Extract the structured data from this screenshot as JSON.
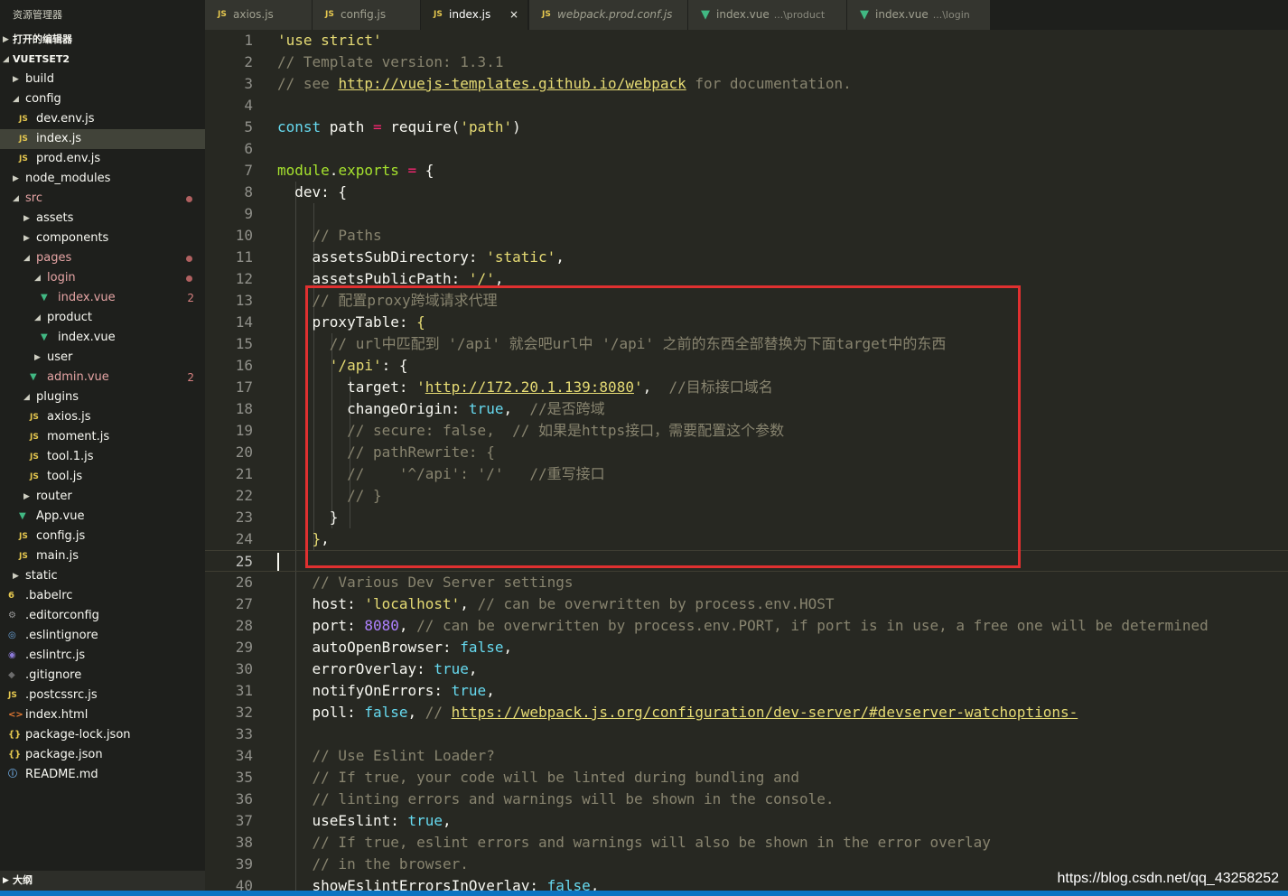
{
  "sidebar": {
    "title": "资源管理器",
    "open_editors": "打开的编辑器",
    "project": "VUETSET2",
    "tree": [
      {
        "name": "build",
        "kind": "folder",
        "depth": 0,
        "expanded": false
      },
      {
        "name": "config",
        "kind": "folder",
        "depth": 0,
        "expanded": true
      },
      {
        "name": "dev.env.js",
        "kind": "js",
        "depth": 1
      },
      {
        "name": "index.js",
        "kind": "js",
        "depth": 1,
        "selected": true
      },
      {
        "name": "prod.env.js",
        "kind": "js",
        "depth": 1
      },
      {
        "name": "node_modules",
        "kind": "folder",
        "depth": 0,
        "expanded": false
      },
      {
        "name": "src",
        "kind": "folder",
        "depth": 0,
        "expanded": true,
        "modified": true,
        "dot": true
      },
      {
        "name": "assets",
        "kind": "folder",
        "depth": 1,
        "expanded": false
      },
      {
        "name": "components",
        "kind": "folder",
        "depth": 1,
        "expanded": false
      },
      {
        "name": "pages",
        "kind": "folder",
        "depth": 1,
        "expanded": true,
        "modified": true,
        "dot": true
      },
      {
        "name": "login",
        "kind": "folder",
        "depth": 2,
        "expanded": true,
        "modified": true,
        "dot": true
      },
      {
        "name": "index.vue",
        "kind": "vue",
        "depth": 3,
        "modified": true,
        "count": "2"
      },
      {
        "name": "product",
        "kind": "folder",
        "depth": 2,
        "expanded": true
      },
      {
        "name": "index.vue",
        "kind": "vue",
        "depth": 3
      },
      {
        "name": "user",
        "kind": "folder",
        "depth": 2,
        "expanded": false
      },
      {
        "name": "admin.vue",
        "kind": "vue",
        "depth": 2,
        "modified": true,
        "count": "2"
      },
      {
        "name": "plugins",
        "kind": "folder",
        "depth": 1,
        "expanded": true
      },
      {
        "name": "axios.js",
        "kind": "js",
        "depth": 2
      },
      {
        "name": "moment.js",
        "kind": "js",
        "depth": 2
      },
      {
        "name": "tool.1.js",
        "kind": "js",
        "depth": 2
      },
      {
        "name": "tool.js",
        "kind": "js",
        "depth": 2
      },
      {
        "name": "router",
        "kind": "folder",
        "depth": 1,
        "expanded": false
      },
      {
        "name": "App.vue",
        "kind": "vue",
        "depth": 1
      },
      {
        "name": "config.js",
        "kind": "js",
        "depth": 1
      },
      {
        "name": "main.js",
        "kind": "js",
        "depth": 1
      },
      {
        "name": "static",
        "kind": "folder",
        "depth": 0,
        "expanded": false
      },
      {
        "name": ".babelrc",
        "kind": "babel",
        "depth": 0
      },
      {
        "name": ".editorconfig",
        "kind": "gear",
        "depth": 0
      },
      {
        "name": ".eslintignore",
        "kind": "eslint-ignore",
        "depth": 0
      },
      {
        "name": ".eslintrc.js",
        "kind": "eslint",
        "depth": 0
      },
      {
        "name": ".gitignore",
        "kind": "git",
        "depth": 0
      },
      {
        "name": ".postcssrc.js",
        "kind": "js",
        "depth": 0
      },
      {
        "name": "index.html",
        "kind": "html",
        "depth": 0
      },
      {
        "name": "package-lock.json",
        "kind": "json",
        "depth": 0
      },
      {
        "name": "package.json",
        "kind": "json",
        "depth": 0
      },
      {
        "name": "README.md",
        "kind": "info",
        "depth": 0
      }
    ],
    "outline": "大纲"
  },
  "icons": {
    "js": "JS",
    "vue": "▼",
    "json": "{}",
    "html": "<>",
    "info": "ⓘ",
    "gear": "⚙",
    "eslint": "◉",
    "eslint-ignore": "◎",
    "git": "◆",
    "babel": "6",
    "caret_right": "▶",
    "caret_down": "◢"
  },
  "tabs": [
    {
      "label": "axios.js",
      "icon": "js"
    },
    {
      "label": "config.js",
      "icon": "js"
    },
    {
      "label": "index.js",
      "icon": "js",
      "active": true,
      "close": "×"
    },
    {
      "label": "webpack.prod.conf.js",
      "icon": "js",
      "italic": true
    },
    {
      "label": "index.vue",
      "icon": "vue",
      "desc": "...\\product"
    },
    {
      "label": "index.vue",
      "icon": "vue",
      "desc": "...\\login"
    }
  ],
  "editor": {
    "current_line": 25,
    "lines": [
      [
        [
          "s",
          "'use strict'"
        ]
      ],
      [
        [
          "c",
          "// Template version: 1.3.1"
        ]
      ],
      [
        [
          "c",
          "// see "
        ],
        [
          "u",
          "http://vuejs-templates.github.io/webpack"
        ],
        [
          "c",
          " for documentation."
        ]
      ],
      [],
      [
        [
          "kw",
          "const "
        ],
        [
          "pl",
          "path "
        ],
        [
          "op",
          "= "
        ],
        [
          "pl",
          "require"
        ],
        [
          "pl",
          "("
        ],
        [
          "s",
          "'path'"
        ],
        [
          "pl",
          ")"
        ]
      ],
      [],
      [
        [
          "pr",
          "module"
        ],
        [
          "pl",
          "."
        ],
        [
          "pr",
          "exports"
        ],
        [
          "pl",
          " "
        ],
        [
          "op",
          "="
        ],
        [
          "pl",
          " {"
        ]
      ],
      [
        [
          "pl",
          "  dev: {"
        ]
      ],
      [],
      [
        [
          "c",
          "    // Paths"
        ]
      ],
      [
        [
          "pl",
          "    assetsSubDirectory: "
        ],
        [
          "s",
          "'static'"
        ],
        [
          "pl",
          ","
        ]
      ],
      [
        [
          "pl",
          "    assetsPublicPath: "
        ],
        [
          "s",
          "'/'"
        ],
        [
          "pl",
          ","
        ]
      ],
      [
        [
          "c",
          "    // 配置proxy跨域请求代理"
        ]
      ],
      [
        [
          "pl",
          "    proxyTable: "
        ],
        [
          "s",
          "{"
        ]
      ],
      [
        [
          "c",
          "      // url中匹配到 '/api' 就会吧url中 '/api' 之前的东西全部替换为下面target中的东西"
        ]
      ],
      [
        [
          "pl",
          "      "
        ],
        [
          "s",
          "'/api'"
        ],
        [
          "pl",
          ": {"
        ]
      ],
      [
        [
          "pl",
          "        target: "
        ],
        [
          "s",
          "'"
        ],
        [
          "u",
          "http://172.20.1.139:8080"
        ],
        [
          "s",
          "'"
        ],
        [
          "pl",
          ",  "
        ],
        [
          "c",
          "//目标接口域名"
        ]
      ],
      [
        [
          "pl",
          "        changeOrigin: "
        ],
        [
          "kw",
          "true"
        ],
        [
          "pl",
          ",  "
        ],
        [
          "c",
          "//是否跨域"
        ]
      ],
      [
        [
          "c",
          "        // secure: false,  // 如果是https接口，需要配置这个参数"
        ]
      ],
      [
        [
          "c",
          "        // pathRewrite: {"
        ]
      ],
      [
        [
          "c",
          "        //    '^/api': '/'   //重写接口"
        ]
      ],
      [
        [
          "c",
          "        // }"
        ]
      ],
      [
        [
          "pl",
          "      }"
        ]
      ],
      [
        [
          "s",
          "    }"
        ],
        [
          "pl",
          ","
        ]
      ],
      [],
      [
        [
          "c",
          "    // Various Dev Server settings"
        ]
      ],
      [
        [
          "pl",
          "    host: "
        ],
        [
          "s",
          "'localhost'"
        ],
        [
          "pl",
          ", "
        ],
        [
          "c",
          "// can be overwritten by process.env.HOST"
        ]
      ],
      [
        [
          "pl",
          "    port: "
        ],
        [
          "v",
          "8080"
        ],
        [
          "pl",
          ", "
        ],
        [
          "c",
          "// can be overwritten by process.env.PORT, if port is in use, a free one will be determined"
        ]
      ],
      [
        [
          "pl",
          "    autoOpenBrowser: "
        ],
        [
          "kw",
          "false"
        ],
        [
          "pl",
          ","
        ]
      ],
      [
        [
          "pl",
          "    errorOverlay: "
        ],
        [
          "kw",
          "true"
        ],
        [
          "pl",
          ","
        ]
      ],
      [
        [
          "pl",
          "    notifyOnErrors: "
        ],
        [
          "kw",
          "true"
        ],
        [
          "pl",
          ","
        ]
      ],
      [
        [
          "pl",
          "    poll: "
        ],
        [
          "kw",
          "false"
        ],
        [
          "pl",
          ", "
        ],
        [
          "c",
          "// "
        ],
        [
          "u",
          "https://webpack.js.org/configuration/dev-server/#devserver-watchoptions-"
        ]
      ],
      [],
      [
        [
          "c",
          "    // Use Eslint Loader?"
        ]
      ],
      [
        [
          "c",
          "    // If true, your code will be linted during bundling and"
        ]
      ],
      [
        [
          "c",
          "    // linting errors and warnings will be shown in the console."
        ]
      ],
      [
        [
          "pl",
          "    useEslint: "
        ],
        [
          "kw",
          "true"
        ],
        [
          "pl",
          ","
        ]
      ],
      [
        [
          "c",
          "    // If true, eslint errors and warnings will also be shown in the error overlay"
        ]
      ],
      [
        [
          "c",
          "    // in the browser."
        ]
      ],
      [
        [
          "pl",
          "    showEslintErrorsInOverlay: "
        ],
        [
          "kw",
          "false"
        ],
        [
          "pl",
          ","
        ]
      ]
    ]
  },
  "watermark": "https://blog.csdn.net/qq_43258252",
  "colors": {
    "highlight_box": "#e03030",
    "status_bar": "#0b74c2"
  }
}
